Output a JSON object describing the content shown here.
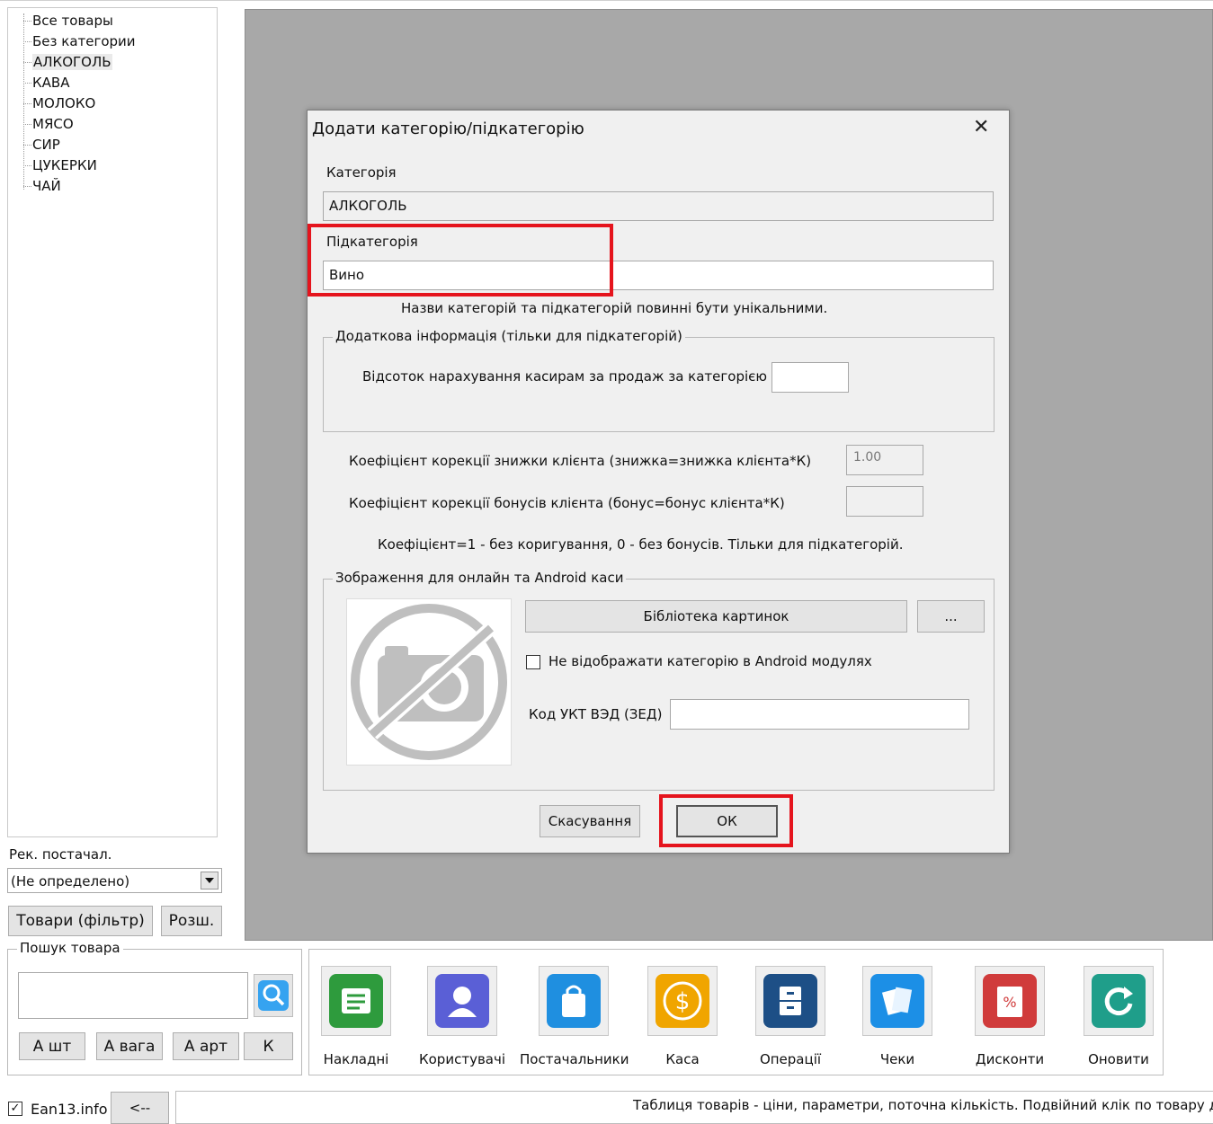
{
  "tree": {
    "items": [
      "Все товары",
      "Без категории",
      "АЛКОГОЛЬ",
      "КАВА",
      "МОЛОКО",
      "МЯСО",
      "СИР",
      "ЦУКЕРКИ",
      "ЧАЙ"
    ],
    "selected_index": 2
  },
  "supplier": {
    "label": "Рек. постачал.",
    "value": "(Не определено)"
  },
  "left_buttons": {
    "goods_filter": "Товари (фільтр)",
    "extended": "Розш."
  },
  "search": {
    "group_title": "Пошук товара",
    "value": "",
    "buttons": [
      "А шт",
      "А вага",
      "А арт",
      "К"
    ]
  },
  "dialog": {
    "title": "Додати категорію/підкатегорію",
    "category_label": "Категорія",
    "category_value": "АЛКОГОЛЬ",
    "subcategory_label": "Підкатегорія",
    "subcategory_value": "Вино",
    "unique_note": "Назви категорій та підкатегорій повинні бути унікальними.",
    "extra_group_title": "Додаткова інформація (тільки для підкатегорій)",
    "percent_label": "Відсоток нарахування касирам за продаж за категорією",
    "percent_value": "",
    "discount_coef_label": "Коефіцієнт корекції знижки клієнта (знижка=знижка клієнта*К)",
    "discount_coef_value": "1.00",
    "bonus_coef_label": "Коефіцієнт корекції бонусів клієнта (бонус=бонус клієнта*К)",
    "bonus_coef_value": "",
    "coef_note": "Коефіцієнт=1 - без коригування, 0 - без бонусів. Тільки для підкатегорій.",
    "image_group_title": "Зображення для онлайн та Android каси",
    "library_button": "Бібліотека картинок",
    "browse_button": "...",
    "hide_android_label": "Не відображати категорію в Android модулях",
    "hide_android_checked": false,
    "ukt_label": "Код УКТ ВЭД (ЗЕД)",
    "ukt_value": "",
    "cancel_button": "Скасування",
    "ok_button": "ОК",
    "close_glyph": "✕"
  },
  "apps": [
    {
      "label": "Накладні",
      "icon": "invoice-icon",
      "color": "#2e9b3d"
    },
    {
      "label": "Користувачі",
      "icon": "user-icon",
      "color": "#5a5fd6"
    },
    {
      "label": "Постачальники",
      "icon": "shopping-bag-icon",
      "color": "#1f8fe0"
    },
    {
      "label": "Каса",
      "icon": "dollar-coin-icon",
      "color": "#f0a500"
    },
    {
      "label": "Операції",
      "icon": "cabinet-icon",
      "color": "#1d4f86"
    },
    {
      "label": "Чеки",
      "icon": "receipts-icon",
      "color": "#1c8fe6"
    },
    {
      "label": "Дисконти",
      "icon": "discount-book-icon",
      "color": "#d03b3b"
    },
    {
      "label": "Оновити",
      "icon": "refresh-icon",
      "color": "#1f9e8a"
    }
  ],
  "status": {
    "ean_label": "Ean13.info",
    "ean_checked": true,
    "back_button": "<--",
    "hint": "Таблиця товарів - ціни, параметри, поточна кількість. Подвійний клік по товару для"
  }
}
